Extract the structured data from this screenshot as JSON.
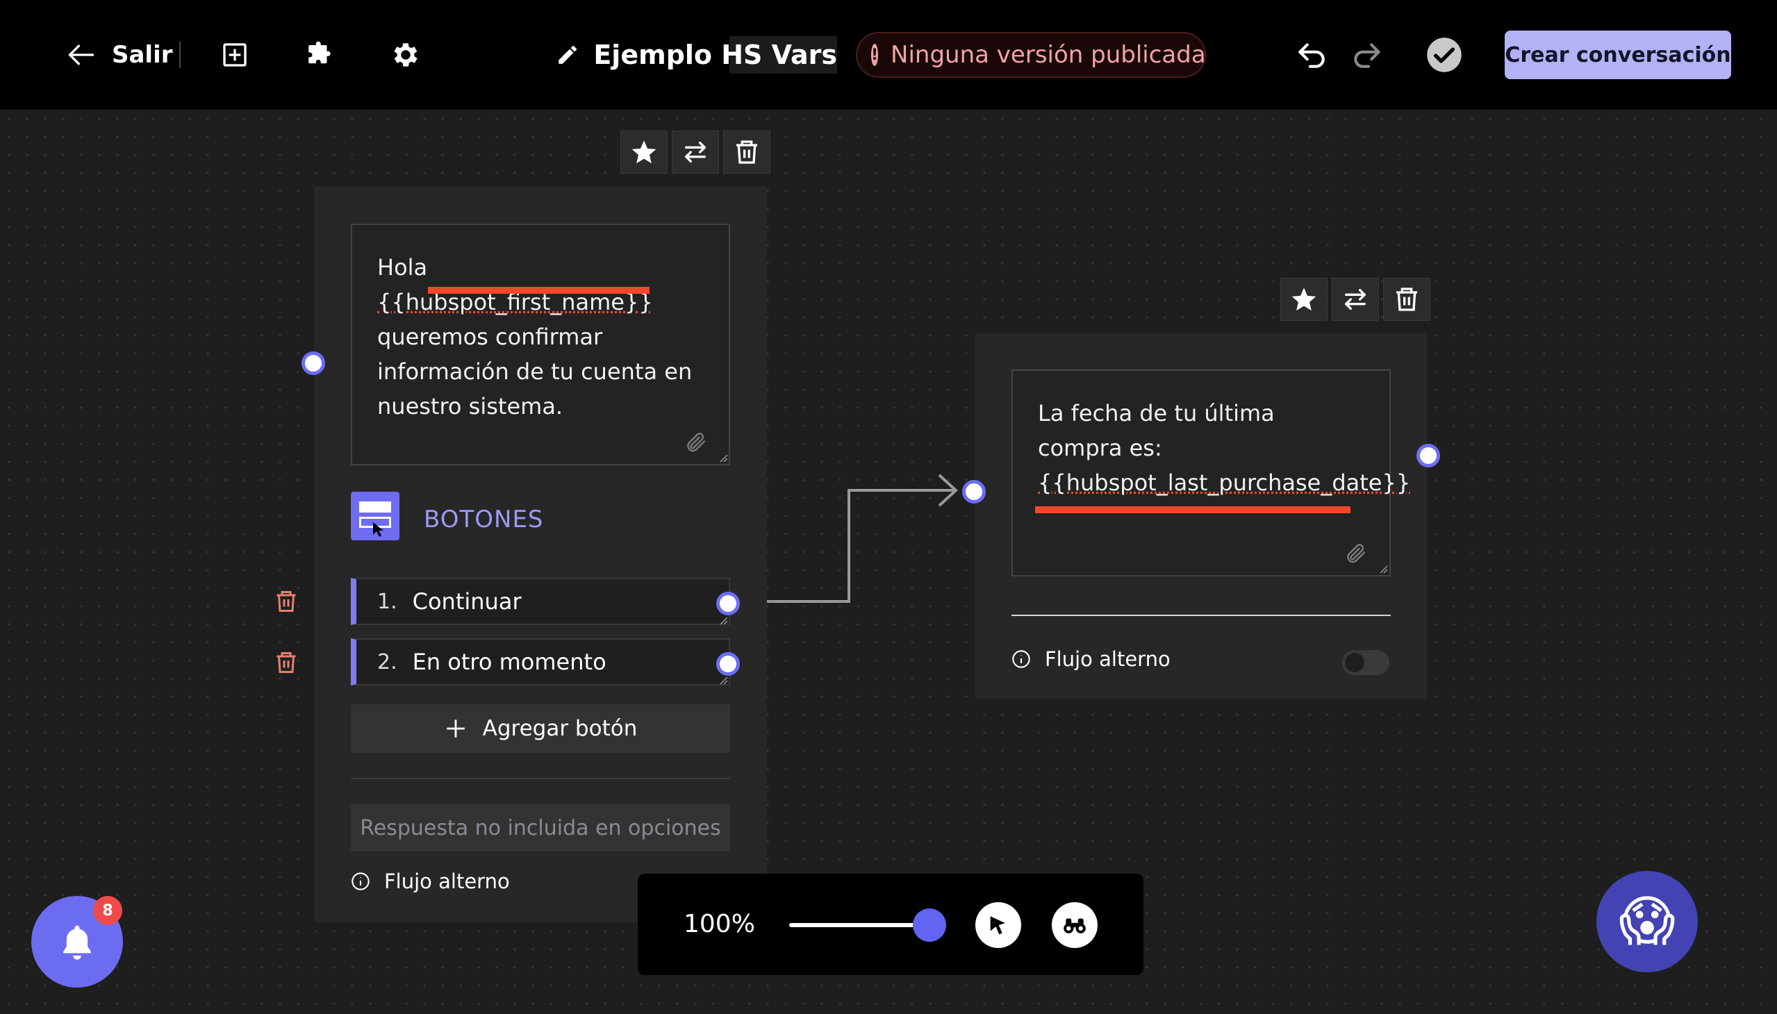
{
  "header": {
    "back_label": "Salir",
    "title": "Ejemplo HS Vars",
    "status_icon": "!",
    "status_text": "Ninguna versión publicada",
    "create_label": "Crear conversación"
  },
  "node1": {
    "message_pre": "Hola ",
    "message_var": "{{hubspot_first_name}}",
    "message_post": " queremos confirmar información de tu cuenta en nuestro sistema.",
    "section_label": "BOTONES",
    "options": [
      {
        "num": "1.",
        "label": "Continuar"
      },
      {
        "num": "2.",
        "label": "En otro momento"
      }
    ],
    "add_button_label": "Agregar botón",
    "fallback_placeholder": "Respuesta no incluida en opciones",
    "alt_flow_label": "Flujo alterno"
  },
  "node2": {
    "message_pre": "La fecha de tu última compra es: ",
    "message_var": "{{hubspot_last_purchase_date}}",
    "alt_flow_label": "Flujo alterno",
    "alt_flow_enabled": false
  },
  "zoom": {
    "label": "100%",
    "level_percent": 100
  },
  "notifications": {
    "count": "8"
  },
  "assistant": {
    "emoji": "😱"
  },
  "colors": {
    "accent": "#6b6ef5",
    "button_primary": "#b3b2f7",
    "highlight": "#f2492a",
    "status_text": "#f3a3a3"
  },
  "icons": [
    "arrow-left-icon",
    "add-square-icon",
    "puzzle-icon",
    "gear-icon",
    "pencil-icon",
    "alert-icon",
    "undo-icon",
    "redo-icon",
    "check-circle-icon",
    "star-icon",
    "swap-icon",
    "trash-icon",
    "paperclip-icon",
    "buttons-icon",
    "plus-icon",
    "info-icon",
    "cursor-icon",
    "binoculars-icon",
    "bell-icon"
  ]
}
